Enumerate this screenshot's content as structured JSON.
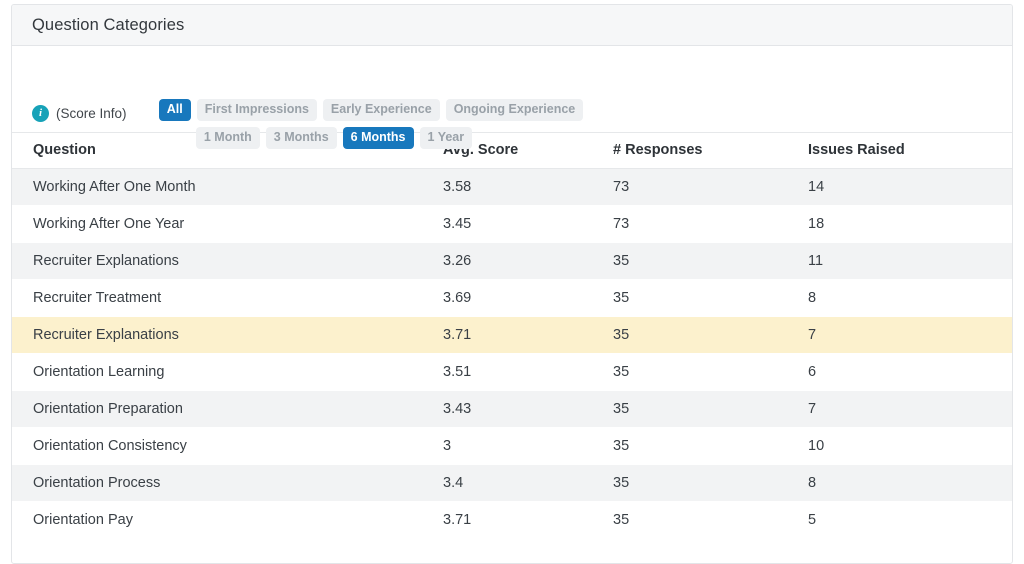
{
  "panel": {
    "title": "Question Categories"
  },
  "score_info": {
    "icon": "info-icon",
    "label": "(Score Info)"
  },
  "filters": {
    "category_row": [
      {
        "label": "All",
        "active": true
      },
      {
        "label": "First Impressions",
        "active": false
      },
      {
        "label": "Early Experience",
        "active": false
      },
      {
        "label": "Ongoing Experience",
        "active": false
      }
    ],
    "period_row": [
      {
        "label": "1 Month",
        "active": false
      },
      {
        "label": "3 Months",
        "active": false
      },
      {
        "label": "6 Months",
        "active": true
      },
      {
        "label": "1 Year",
        "active": false
      }
    ],
    "active_color": "#1878bd",
    "inactive_bg": "#eef0f2",
    "inactive_color": "#99a1a8"
  },
  "table": {
    "columns": [
      "Question",
      "Avg. Score",
      "# Responses",
      "Issues Raised"
    ],
    "rows": [
      {
        "question": "Working After One Month",
        "avg_score": "3.58",
        "responses": "73",
        "issues": "14",
        "highlight": false
      },
      {
        "question": "Working After One Year",
        "avg_score": "3.45",
        "responses": "73",
        "issues": "18",
        "highlight": false
      },
      {
        "question": "Recruiter Explanations",
        "avg_score": "3.26",
        "responses": "35",
        "issues": "11",
        "highlight": false
      },
      {
        "question": "Recruiter Treatment",
        "avg_score": "3.69",
        "responses": "35",
        "issues": "8",
        "highlight": false
      },
      {
        "question": "Recruiter Explanations",
        "avg_score": "3.71",
        "responses": "35",
        "issues": "7",
        "highlight": true
      },
      {
        "question": "Orientation Learning",
        "avg_score": "3.51",
        "responses": "35",
        "issues": "6",
        "highlight": false
      },
      {
        "question": "Orientation Preparation",
        "avg_score": "3.43",
        "responses": "35",
        "issues": "7",
        "highlight": false
      },
      {
        "question": "Orientation Consistency",
        "avg_score": "3",
        "responses": "35",
        "issues": "10",
        "highlight": false
      },
      {
        "question": "Orientation Process",
        "avg_score": "3.4",
        "responses": "35",
        "issues": "8",
        "highlight": false
      },
      {
        "question": "Orientation Pay",
        "avg_score": "3.71",
        "responses": "35",
        "issues": "5",
        "highlight": false
      }
    ],
    "highlight_color": "#fcf1cd",
    "stripe_color": "#f2f3f4"
  }
}
